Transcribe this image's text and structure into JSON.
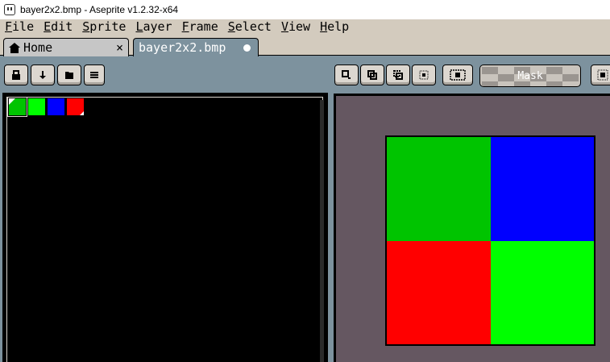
{
  "window": {
    "title": "bayer2x2.bmp - Aseprite v1.2.32-x64"
  },
  "menu": [
    {
      "first": "F",
      "rest": "ile"
    },
    {
      "first": "E",
      "rest": "dit"
    },
    {
      "first": "S",
      "rest": "prite"
    },
    {
      "first": "L",
      "rest": "ayer"
    },
    {
      "first": "F",
      "rest": "rame"
    },
    {
      "first": "S",
      "rest": "elect"
    },
    {
      "first": "V",
      "rest": "iew"
    },
    {
      "first": "H",
      "rest": "elp"
    }
  ],
  "tabs": {
    "home": {
      "label": "Home",
      "close": "×"
    },
    "file": {
      "label": "bayer2x2.bmp"
    }
  },
  "toolbar": {
    "mask_label": "Mask"
  },
  "palette": {
    "colors": [
      "#00c400",
      "#00ff00",
      "#0000ff",
      "#ff0000"
    ],
    "selected_index": 0
  },
  "sprite": {
    "name": "bayer2x2.bmp",
    "width": 2,
    "height": 2,
    "pixels": [
      "#00c400",
      "#0000ff",
      "#ff0000",
      "#00ff00"
    ]
  },
  "colors": {
    "workspace": "#7d929e",
    "menubar": "#d3cbbe",
    "canvas_background": "#655761"
  }
}
